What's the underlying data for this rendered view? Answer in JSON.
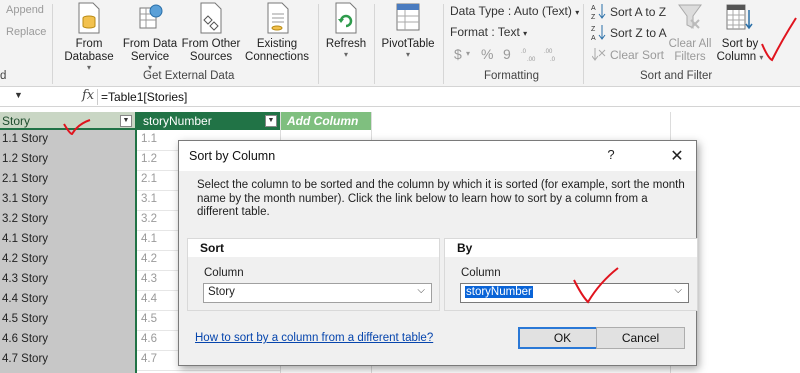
{
  "ribbon": {
    "append": "Append",
    "replace": "Replace",
    "from_database": [
      "From",
      "Database"
    ],
    "from_data_service": [
      "From Data",
      "Service"
    ],
    "from_other_sources": [
      "From Other",
      "Sources"
    ],
    "existing_connections": [
      "Existing",
      "Connections"
    ],
    "refresh": "Refresh",
    "pivottable": "PivotTable",
    "get_external_data": "Get External Data",
    "data_type": "Data Type : Auto (Text)",
    "format": "Format : Text",
    "currency_symbol": "$",
    "percent_symbol": "%",
    "comma_symbol": "9",
    "formatting": "Formatting",
    "sort_a_to_z": "Sort A to Z",
    "sort_z_to_a": "Sort Z to A",
    "clear_sort": "Clear Sort",
    "clear_all_filters": [
      "Clear All",
      "Filters"
    ],
    "sort_by_column": [
      "Sort by",
      "Column"
    ],
    "sort_and_filter": "Sort and Filter",
    "left_fragment": "d"
  },
  "formula_bar": {
    "fx": "fx",
    "formula": "=Table1[Stories]"
  },
  "grid": {
    "col_story": "Story",
    "col_story_number": "storyNumber",
    "col_add": "Add Column",
    "stories": [
      "1.1 Story",
      "1.2 Story",
      "2.1 Story",
      "3.1 Story",
      "3.2 Story",
      "4.1 Story",
      "4.2 Story",
      "4.3 Story",
      "4.4 Story",
      "4.5 Story",
      "4.6 Story",
      "4.7 Story"
    ],
    "story_numbers": [
      "1.1",
      "1.2",
      "2.1",
      "3.1",
      "3.2",
      "4.1",
      "4.2",
      "4.3",
      "4.4",
      "4.5",
      "4.6",
      "4.7"
    ]
  },
  "dialog": {
    "title": "Sort by Column",
    "help": "?",
    "close": "✕",
    "description": "Select the column to be sorted and the column by which it is sorted (for example, sort the month name by the month number). Click the link below to learn how to sort by a column from a different table.",
    "sort_heading": "Sort",
    "by_heading": "By",
    "sort_column_label": "Column",
    "by_column_label": "Column",
    "sort_column_value": "Story",
    "by_column_value": "storyNumber",
    "link": "How to sort by a column from a different table?",
    "ok": "OK",
    "cancel": "Cancel"
  },
  "colors": {
    "accent_green": "#217346",
    "annotation_red": "#e0141e",
    "link_blue": "#0645ad"
  }
}
